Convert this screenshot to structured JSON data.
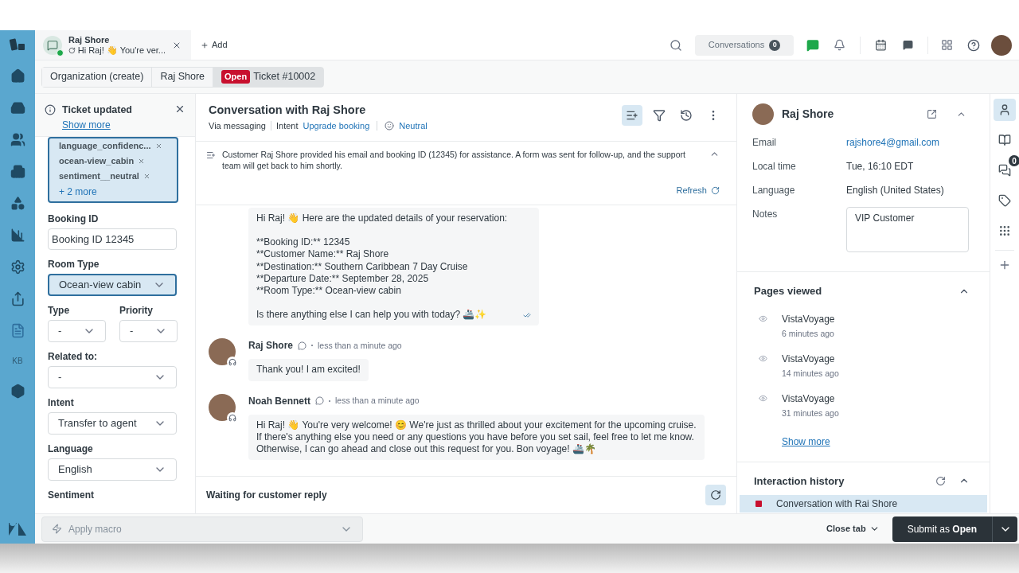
{
  "top_tab": {
    "name": "Raj Shore",
    "preview": "Hi Raj! 👋 You're ver...",
    "online": true
  },
  "add_tab": "Add",
  "nav_kb": "KB",
  "header": {
    "conversations": "Conversations",
    "count": "0"
  },
  "breadcrumbs": [
    {
      "label": "Organization (create)",
      "selected": false
    },
    {
      "label": "Raj Shore",
      "selected": false
    },
    {
      "label": "Ticket #10002",
      "status": "Open",
      "selected": true
    }
  ],
  "notice": {
    "title": "Ticket updated",
    "link": "Show more"
  },
  "tags": [
    "language_confidenc...",
    "ocean-view_cabin",
    "sentiment__neutral"
  ],
  "tags_more": "+ 2 more",
  "fields": [
    {
      "kind": "text",
      "label": "Booking ID",
      "value": "Booking ID 12345"
    },
    {
      "kind": "select",
      "label": "Room Type",
      "value": "Ocean-view cabin",
      "focused": true
    },
    {
      "kind": "pair",
      "items": [
        {
          "label": "Type",
          "value": "-"
        },
        {
          "label": "Priority",
          "value": "-"
        }
      ]
    },
    {
      "kind": "select",
      "label": "Related to:",
      "value": "-",
      "focused": false
    },
    {
      "kind": "select",
      "label": "Intent",
      "value": "Transfer to agent",
      "focused": false
    },
    {
      "kind": "select",
      "label": "Language",
      "value": "English",
      "focused": false
    },
    {
      "kind": "label",
      "label": "Sentiment"
    }
  ],
  "conversation": {
    "title": "Conversation with Raj Shore",
    "channel": "Via messaging",
    "intent_label": "Intent",
    "intent": "Upgrade booking",
    "sentiment": "Neutral",
    "summary": "Customer Raj Shore provided his email and booking ID (12345) for assistance. A form was sent for follow-up, and the support team will get back to him shortly.",
    "refresh": "Refresh",
    "messages": [
      {
        "kind": "continued",
        "read": true,
        "paragraphs": [
          [
            "Hi Raj! 👋 Here are the updated details of your reservation:"
          ],
          [
            "**Booking ID:** 12345",
            "**Customer Name:** Raj Shore",
            "**Destination:** Southern Caribbean 7 Day Cruise",
            "**Departure Date:** September 28, 2025",
            "**Room Type:** Ocean-view cabin"
          ],
          [
            "Is there anything else I can help you with today? 🚢✨"
          ]
        ]
      },
      {
        "kind": "full",
        "author": "Raj Shore",
        "time": "less than a minute ago",
        "paragraphs": [
          [
            "Thank you! I am excited!"
          ]
        ]
      },
      {
        "kind": "full",
        "author": "Noah Bennett",
        "time": "less than a minute ago",
        "paragraphs": [
          [
            "Hi Raj! 👋 You're very welcome! 😊 We're just as thrilled about your excitement for the upcoming cruise. If there's anything else you need or any questions you have before you set sail, feel free to let me know. Otherwise, I can go ahead and close out this request for you. Bon voyage! 🚢🌴"
          ]
        ]
      }
    ],
    "status": "Waiting for customer reply"
  },
  "customer": {
    "name": "Raj Shore",
    "fields": [
      {
        "kind": "link",
        "label": "Email",
        "value": "rajshore4@gmail.com"
      },
      {
        "kind": "text",
        "label": "Local time",
        "value": "Tue, 16:10 EDT"
      },
      {
        "kind": "text",
        "label": "Language",
        "value": "English (United States)"
      },
      {
        "kind": "notes",
        "label": "Notes",
        "value": "VIP Customer"
      }
    ]
  },
  "pages_viewed": {
    "title": "Pages viewed",
    "items": [
      {
        "page": "VistaVoyage",
        "time": "6 minutes ago"
      },
      {
        "page": "VistaVoyage",
        "time": "14 minutes ago"
      },
      {
        "page": "VistaVoyage",
        "time": "31 minutes ago"
      }
    ],
    "more": "Show more"
  },
  "interaction_history": {
    "title": "Interaction history",
    "items": [
      {
        "title": "Conversation with Rai Shore",
        "selected": true,
        "color": "#c8102e"
      }
    ]
  },
  "rail": [
    {
      "kind": "user",
      "selected": true
    },
    {
      "kind": "book",
      "selected": false
    },
    {
      "kind": "chats",
      "selected": false,
      "badge": "0"
    },
    {
      "kind": "tag",
      "selected": false
    },
    {
      "kind": "apps",
      "selected": false
    }
  ],
  "footer": {
    "macro": "Apply macro",
    "close": "Close tab",
    "submit": "Submit as **Open**"
  }
}
